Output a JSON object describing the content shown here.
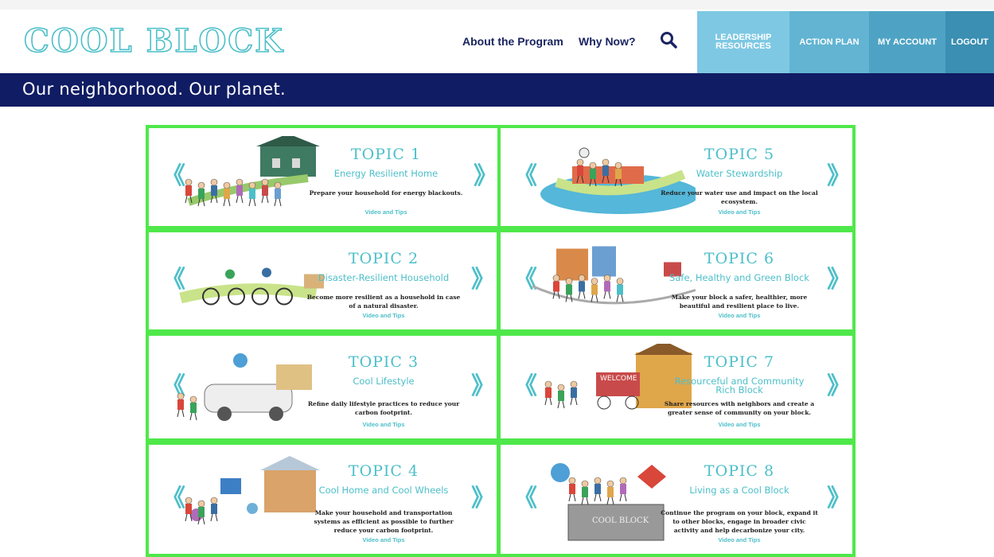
{
  "header": {
    "logo_text": "COOL BLOCK",
    "nav": [
      "About the Program",
      "Why Now?"
    ],
    "search_icon": "search-icon",
    "buttons": [
      "LEADERSHIP RESOURCES",
      "ACTION PLAN",
      "MY ACCOUNT",
      "LOGOUT"
    ],
    "button_colors": [
      "#7ec8e3",
      "#62b4d2",
      "#4ea3c4",
      "#3a8fb2"
    ],
    "tagline": "Our neighborhood. Our planet."
  },
  "colors": {
    "accent": "#4dbfc9",
    "navy": "#101c63",
    "highlight": "#4fe84a"
  },
  "topics": [
    {
      "title": "TOPIC 1",
      "subtitle": "Energy Resilient Home",
      "description": "Prepare your household for energy blackouts.",
      "link": "Video and Tips"
    },
    {
      "title": "TOPIC 2",
      "subtitle": "Disaster-Resilient Household",
      "description": "Become more resilient as a household in case of a natural disaster.",
      "link": "Video and Tips"
    },
    {
      "title": "TOPIC 3",
      "subtitle": "Cool Lifestyle",
      "description": "Refine daily lifestyle practices to reduce your carbon footprint.",
      "link": "Video and Tips"
    },
    {
      "title": "TOPIC 4",
      "subtitle": "Cool Home and Cool Wheels",
      "description": "Make your household and transportation systems as efficient as possible to further reduce your carbon footprint.",
      "link": "Video and Tips"
    },
    {
      "title": "TOPIC 5",
      "subtitle": "Water Stewardship",
      "description": "Reduce your water use and impact on the local ecosystem.",
      "link": "Video and Tips"
    },
    {
      "title": "TOPIC 6",
      "subtitle": "Safe, Healthy and Green Block",
      "description": "Make your block a safer, healthier, more beautiful and resilient place to live.",
      "link": "Video and Tips"
    },
    {
      "title": "TOPIC 7",
      "subtitle": "Resourceful and Community Rich Block",
      "description": "Share resources with neighbors and create a greater sense of community on your block.",
      "link": "Video and Tips"
    },
    {
      "title": "TOPIC 8",
      "subtitle": "Living as a Cool Block",
      "description": "Continue the program on your block, expand it to other blocks, engage in broader civic activity and help decarbonize your city.",
      "link": "Video and Tips"
    }
  ],
  "arrows": {
    "left": "《",
    "right": "》"
  }
}
